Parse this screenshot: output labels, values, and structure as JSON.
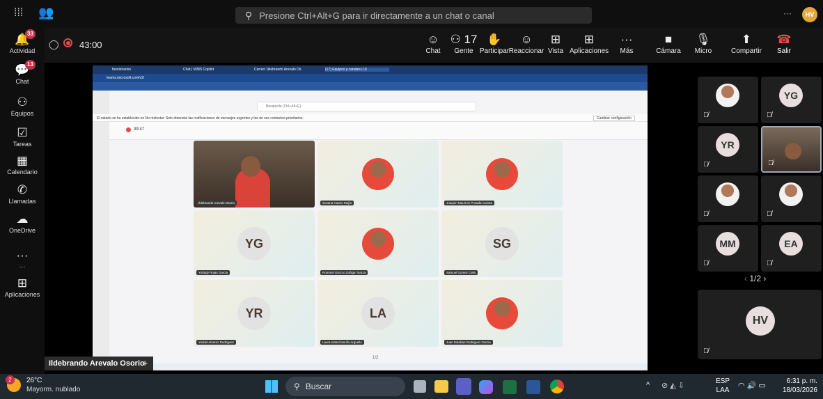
{
  "search": {
    "placeholder": "Presione Ctrl+Alt+G para ir directamente a un chat o canal"
  },
  "titlebar": {
    "more": "···",
    "avatar": "HV"
  },
  "rail": [
    {
      "label": "Actividad",
      "icon": "bell-icon",
      "badge": "33"
    },
    {
      "label": "Chat",
      "icon": "chat-icon",
      "badge": "13"
    },
    {
      "label": "Equipos",
      "icon": "teams-icon",
      "badge": ""
    },
    {
      "label": "Tareas",
      "icon": "tasks-icon",
      "badge": ""
    },
    {
      "label": "Calendario",
      "icon": "calendar-icon",
      "badge": ""
    },
    {
      "label": "Llamadas",
      "icon": "phone-icon",
      "badge": ""
    },
    {
      "label": "OneDrive",
      "icon": "onedrive-icon",
      "badge": ""
    },
    {
      "label": "···",
      "icon": "more-icon",
      "badge": ""
    },
    {
      "label": "Aplicaciones",
      "icon": "apps-icon",
      "badge": ""
    }
  ],
  "meeting": {
    "timer": "43:00"
  },
  "toolbar": [
    {
      "label": "Chat",
      "glyph": "☺"
    },
    {
      "label": "Gente",
      "glyph": "⚇ 17"
    },
    {
      "label": "Participar",
      "glyph": "✋"
    },
    {
      "label": "Reaccionar",
      "glyph": "☺"
    },
    {
      "label": "Vista",
      "glyph": "⊞"
    },
    {
      "label": "Aplicaciones",
      "glyph": "⊞"
    },
    {
      "label": "Más",
      "glyph": "···"
    },
    {
      "label": "Cámara",
      "glyph": "■"
    },
    {
      "label": "Micro",
      "glyph": "🎙"
    },
    {
      "label": "Compartir",
      "glyph": "⬆"
    },
    {
      "label": "Salir",
      "glyph": "☎"
    }
  ],
  "side": {
    "tiles": [
      {
        "kind": "photo",
        "initials": ""
      },
      {
        "kind": "initials",
        "initials": "YG"
      },
      {
        "kind": "initials",
        "initials": "YR"
      },
      {
        "kind": "photo",
        "initials": ""
      },
      {
        "kind": "photo",
        "initials": ""
      },
      {
        "kind": "photo",
        "initials": ""
      },
      {
        "kind": "initials",
        "initials": "MM"
      },
      {
        "kind": "initials",
        "initials": "EA"
      }
    ],
    "pager": "1/2",
    "self": "HV"
  },
  "inner": {
    "tabs": [
      "funcionarios",
      "Chat | M365 Copilot",
      "Correo: Ildebrando Arevalo Os",
      "(17) Equipos y canales | Ul"
    ],
    "url": "teams.microsoft.com/v2/",
    "search": "Búsqueda (Ctrl+Alt+E)",
    "notice": "El estado se ha establecido en No molestar. Solo obtendrá las notificaciones de mensajes urgentes y las de sus contactos prioritarios.",
    "notice_btn": "Cambiar configuración",
    "timer": "39:47",
    "grid": [
      {
        "name": "Ildebrando Arevalo Osorio",
        "initials": "",
        "kind": "camera"
      },
      {
        "name": "Susana Castro Mejía",
        "initials": "",
        "kind": "photo"
      },
      {
        "name": "Joaquin Mauricio Posada Cuesta",
        "initials": "",
        "kind": "photo"
      },
      {
        "name": "Yorlady Rojas Garcia",
        "initials": "YG",
        "kind": "initials"
      },
      {
        "name": "Rommel Orozco Zuñiga Taraza",
        "initials": "",
        "kind": "photo"
      },
      {
        "name": "Samuel Gomez Celis",
        "initials": "SG",
        "kind": "initials"
      },
      {
        "name": "Yorkiel Alvarez Rodriguez",
        "initials": "YR",
        "kind": "initials"
      },
      {
        "name": "Laura Isabel Murillo Arguello",
        "initials": "LA",
        "kind": "initials"
      },
      {
        "name": "Juan Esteban Rodriguez Garcia",
        "initials": "",
        "kind": "photo"
      }
    ],
    "pager": "1/2"
  },
  "caption": "Ildebrando Arevalo Osorio",
  "taskbar": {
    "weather_temp": "26°C",
    "weather_desc": "Mayorm. nublado",
    "weather_badge": "2",
    "search": "Buscar",
    "lang1": "ESP",
    "lang2": "LAA",
    "time": "6:31 p. m.",
    "date": "18/03/2026"
  }
}
